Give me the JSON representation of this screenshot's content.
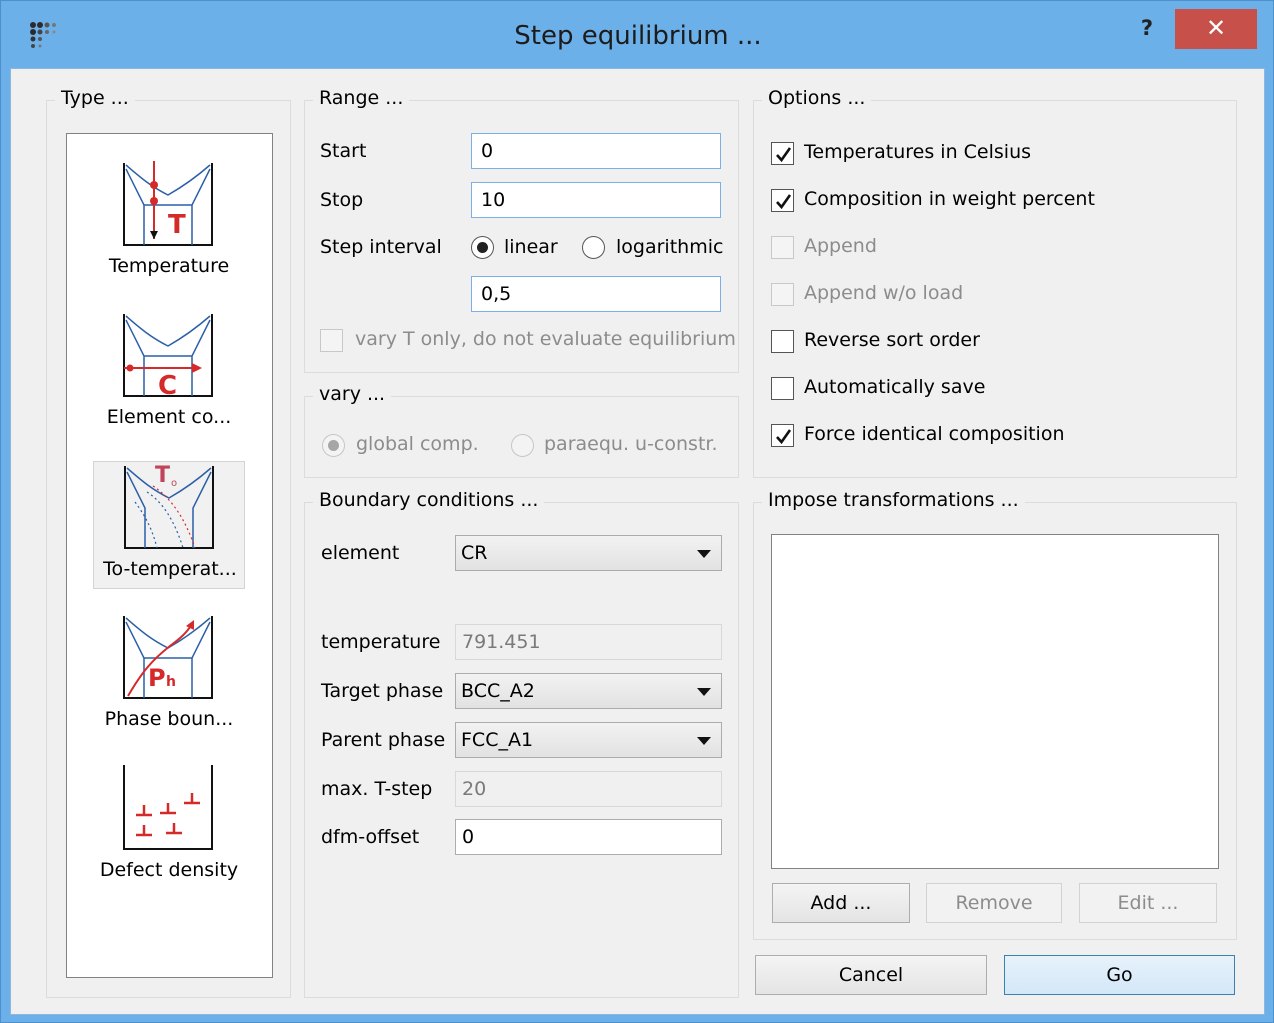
{
  "window": {
    "title": "Step equilibrium ...",
    "help_label": "?",
    "close_label": "✕",
    "app_icon": "app-dots-icon"
  },
  "type_group": {
    "title": "Type ...",
    "items": [
      {
        "label": "Temperature",
        "icon": "temperature-diagram-icon",
        "selected": false
      },
      {
        "label": "Element co...",
        "icon": "element-composition-diagram-icon",
        "selected": false
      },
      {
        "label": "To-temperat...",
        "icon": "to-temperature-diagram-icon",
        "selected": true
      },
      {
        "label": "Phase boun...",
        "icon": "phase-boundary-diagram-icon",
        "selected": false
      },
      {
        "label": "Defect density",
        "icon": "defect-density-diagram-icon",
        "selected": false
      }
    ]
  },
  "range": {
    "title": "Range ...",
    "start_label": "Start",
    "start_value": "0",
    "stop_label": "Stop",
    "stop_value": "10",
    "step_interval_label": "Step interval",
    "linear_label": "linear",
    "log_label": "logarithmic",
    "interval_value": "0,5",
    "vary_t_label": "vary T only, do not evaluate equilibrium"
  },
  "vary": {
    "title": "vary ...",
    "global_label": "global comp.",
    "paraequ_label": "paraequ. u-constr."
  },
  "boundary": {
    "title": "Boundary conditions ...",
    "element_label": "element",
    "element_value": "CR",
    "temperature_label": "temperature",
    "temperature_value": "791.451",
    "target_label": "Target phase",
    "target_value": "BCC_A2",
    "parent_label": "Parent phase",
    "parent_value": "FCC_A1",
    "maxt_label": "max. T-step",
    "maxt_value": "20",
    "dfm_label": "dfm-offset",
    "dfm_value": "0"
  },
  "options": {
    "title": "Options ...",
    "items": [
      {
        "label": "Temperatures in Celsius",
        "checked": true,
        "enabled": true
      },
      {
        "label": "Composition in weight percent",
        "checked": true,
        "enabled": true
      },
      {
        "label": "Append",
        "checked": false,
        "enabled": false
      },
      {
        "label": "Append w/o load",
        "checked": false,
        "enabled": false
      },
      {
        "label": "Reverse sort order",
        "checked": false,
        "enabled": true
      },
      {
        "label": "Automatically save",
        "checked": false,
        "enabled": true
      },
      {
        "label": "Force identical composition",
        "checked": true,
        "enabled": true
      }
    ]
  },
  "transform": {
    "title": "Impose transformations ...",
    "add_label": "Add ...",
    "remove_label": "Remove",
    "edit_label": "Edit ..."
  },
  "footer": {
    "cancel_label": "Cancel",
    "go_label": "Go"
  },
  "colors": {
    "frame": "#6cb0ea",
    "close": "#c7504a",
    "diagram_red": "#d42a2a",
    "diagram_blue": "#2b5fa8"
  }
}
